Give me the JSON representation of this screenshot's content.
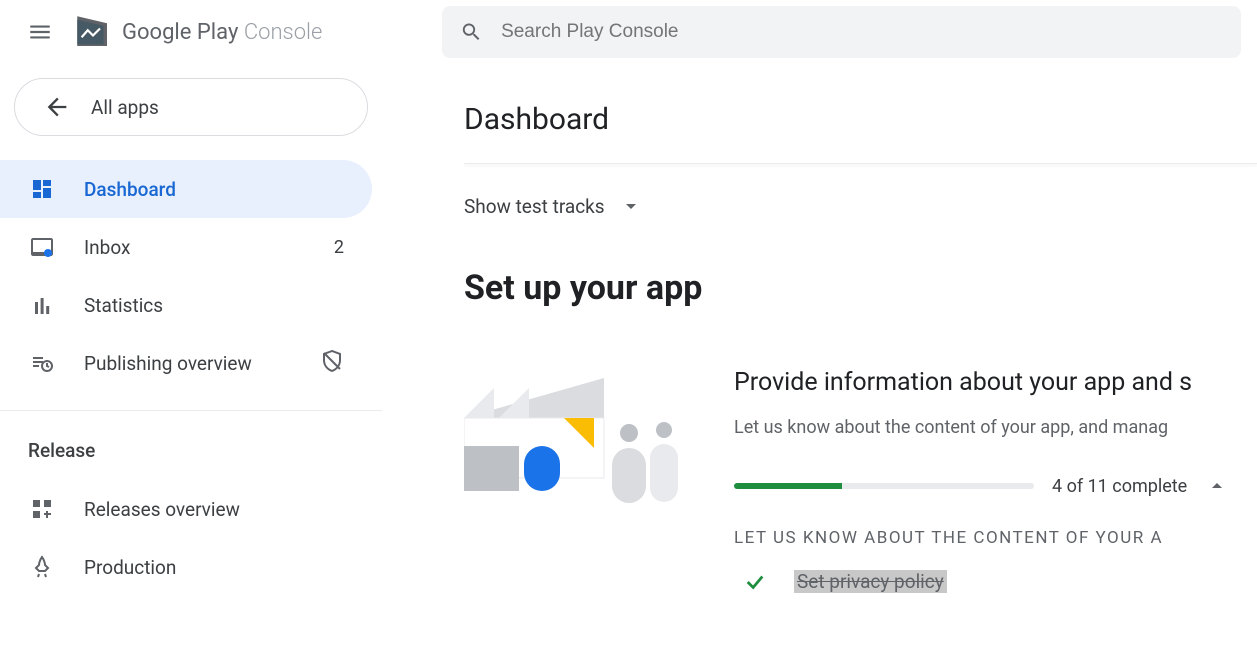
{
  "brand": {
    "name": "Google Play",
    "suffix": "Console"
  },
  "search": {
    "placeholder": "Search Play Console"
  },
  "sidebar": {
    "all_apps_label": "All apps",
    "items": [
      {
        "label": "Dashboard"
      },
      {
        "label": "Inbox",
        "badge": "2"
      },
      {
        "label": "Statistics"
      },
      {
        "label": "Publishing overview"
      }
    ],
    "section_release": "Release",
    "release_items": [
      {
        "label": "Releases overview"
      },
      {
        "label": "Production"
      }
    ]
  },
  "main": {
    "page_title": "Dashboard",
    "show_test_tracks": "Show test tracks",
    "setup_heading": "Set up your app",
    "setup_card": {
      "title": "Provide information about your app and s",
      "desc": "Let us know about the content of your app, and manag",
      "progress_text": "4 of 11 complete",
      "task_section_label": "LET US KNOW ABOUT THE CONTENT OF YOUR A",
      "tasks": [
        {
          "label": "Set privacy policy",
          "done": true
        }
      ]
    }
  }
}
